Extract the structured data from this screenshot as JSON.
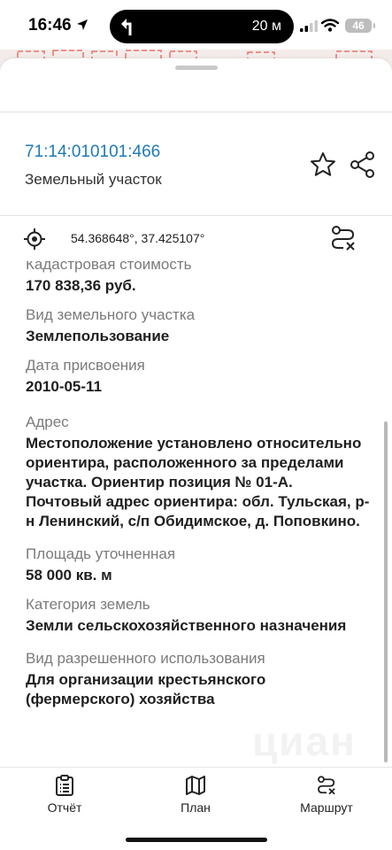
{
  "status_bar": {
    "time": "16:46",
    "nav_distance": "20 м",
    "battery": "46"
  },
  "header": {
    "cadastral_number": "71:14:010101:466",
    "object_type": "Земельный участок"
  },
  "coordinates": "54.368648°, 37.425107°",
  "fields": [
    {
      "label": "Кадастровая стоимость",
      "value": "170 838,36 руб."
    },
    {
      "label": "Вид земельного участка",
      "value": "Землепользование"
    },
    {
      "label": "Дата присвоения",
      "value": "2010-05-11"
    },
    {
      "label": "Адрес",
      "value": "Местоположение установлено относительно ориентира, расположенного за пределами участка. Ориентир позиция № 01-А. Почтовый адрес ориентира: обл. Тульская, р-н Ленинский, с/п Обидимское, д. Поповкино."
    },
    {
      "label": "Площадь уточненная",
      "value": "58 000 кв. м"
    },
    {
      "label": "Категория земель",
      "value": "Земли сельскохозяйственного назначения"
    },
    {
      "label": "Вид разрешенного использования",
      "value": "Для организации крестьянского (фермерского) хозяйства"
    }
  ],
  "watermark": "циан",
  "bottom_nav": {
    "report": "Отчёт",
    "plan": "План",
    "route": "Маршрут"
  },
  "icons": {
    "favorite": "star-outline-icon",
    "share": "share-icon",
    "target": "crosshair-icon",
    "route": "route-icon",
    "report": "clipboard-icon",
    "plan": "map-icon",
    "route_tab": "route-icon"
  },
  "colors": {
    "cadastral_link": "#1f7ab5",
    "label": "#7b7b7b",
    "value": "#1f1f1f"
  }
}
